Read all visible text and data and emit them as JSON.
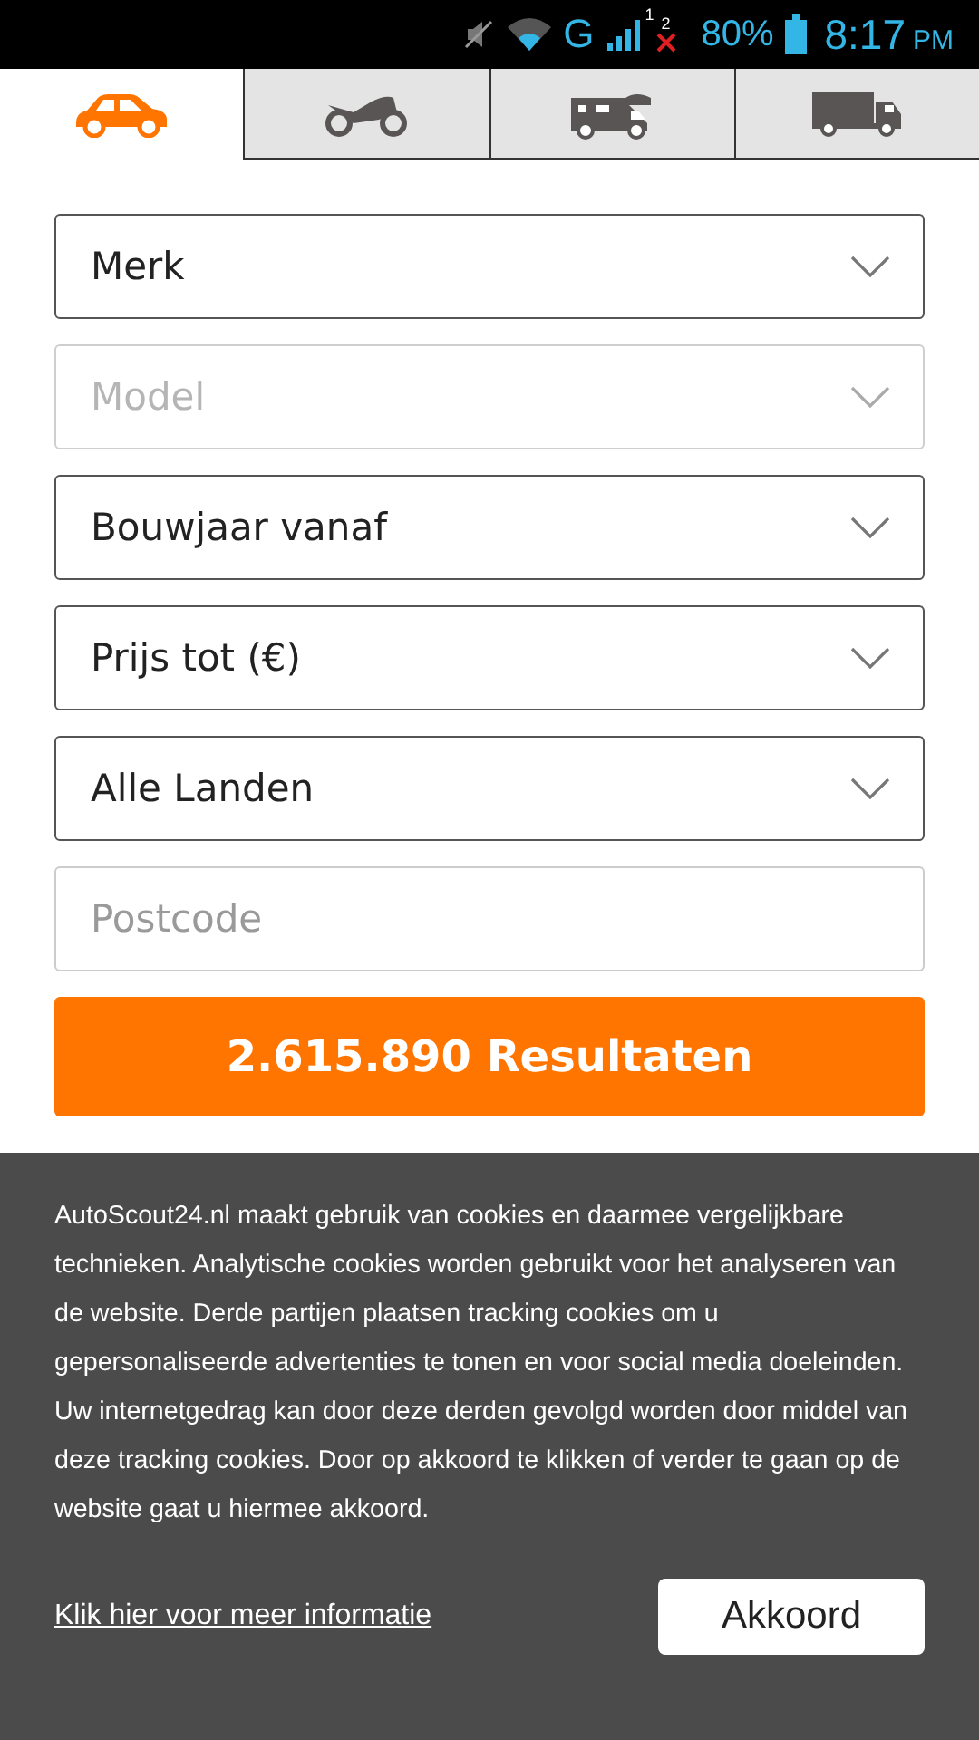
{
  "status_bar": {
    "network": "G",
    "sim1": "1",
    "sim2": "2",
    "battery": "80%",
    "time": "8:17",
    "ampm": "PM"
  },
  "tabs": [
    {
      "kind": "car",
      "selected": true
    },
    {
      "kind": "motorbike",
      "selected": false
    },
    {
      "kind": "camper",
      "selected": false
    },
    {
      "kind": "truck",
      "selected": false
    }
  ],
  "fields": [
    {
      "kind": "select",
      "value": "Merk",
      "disabled": false
    },
    {
      "kind": "select",
      "placeholder": "Model",
      "disabled": true
    },
    {
      "kind": "select",
      "value": "Bouwjaar vanaf",
      "disabled": false
    },
    {
      "kind": "select",
      "value": "Prijs tot (€)",
      "disabled": false
    },
    {
      "kind": "select",
      "value": "Alle Landen",
      "disabled": false
    },
    {
      "kind": "input",
      "placeholder": "Postcode"
    }
  ],
  "results_button": "2.615.890 Resultaten",
  "cookie_banner": {
    "text": "AutoScout24.nl maakt gebruik van cookies en daarmee vergelijkbare technieken. Analytische cookies worden gebruikt voor het analyseren van de website. Derde partijen plaatsen tracking cookies om u gepersonaliseerde advertenties te tonen en voor social media doeleinden. Uw internetgedrag kan door deze derden gevolgd worden door middel van deze tracking cookies. Door op akkoord te klikken of verder te gaan op de website gaat u hiermee akkoord.",
    "link": "Klik hier voor meer informatie",
    "button": "Akkoord"
  }
}
